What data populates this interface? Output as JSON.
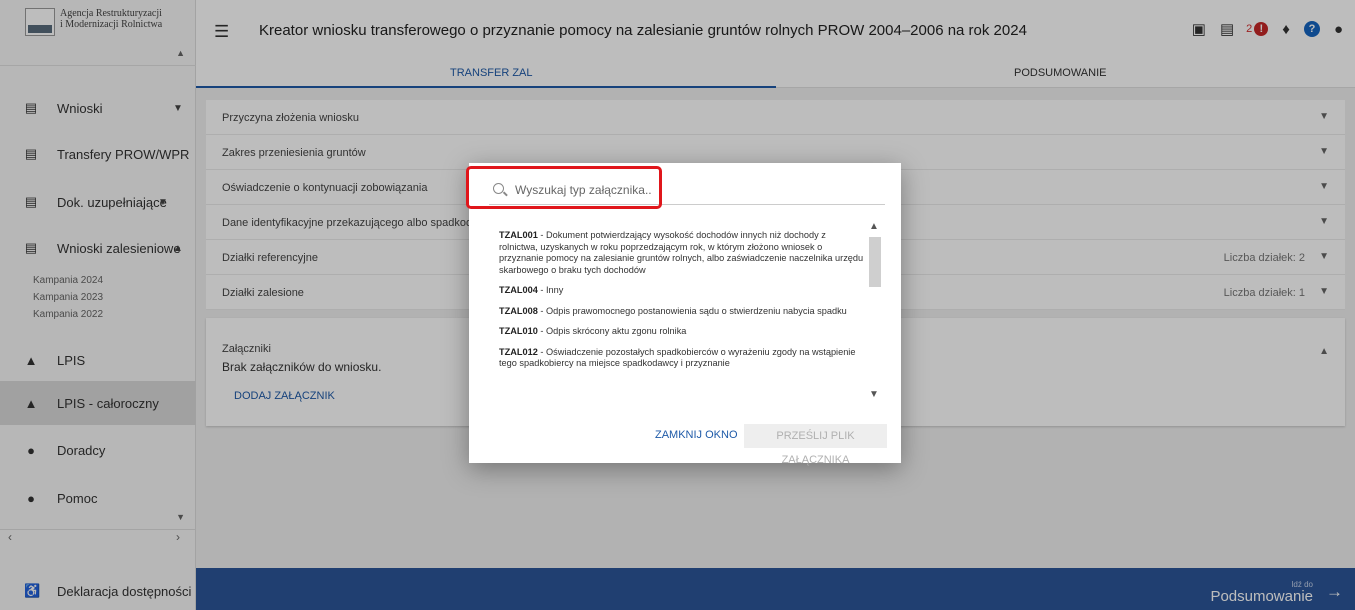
{
  "sidebar": {
    "logo_line1": "Agencja Restrukturyzacji",
    "logo_line2": "i Modernizacji Rolnictwa",
    "items": [
      {
        "label": "Wnioski",
        "icon": "clipboard-icon"
      },
      {
        "label": "Transfery PROW/WPR",
        "icon": "clipboard-icon"
      },
      {
        "label": "Dok. uzupełniające",
        "icon": "clipboard-icon"
      },
      {
        "label": "Wnioski zalesieniowe",
        "icon": "clipboard-icon"
      },
      {
        "label": "LPIS",
        "icon": "mountain-icon"
      },
      {
        "label": "LPIS - całoroczny",
        "icon": "mountain-icon"
      },
      {
        "label": "Doradcy",
        "icon": "person-icon"
      },
      {
        "label": "Pomoc",
        "icon": "help-icon"
      }
    ],
    "campaigns": [
      "Kampania 2024",
      "Kampania 2023",
      "Kampania 2022"
    ],
    "accessibility": "Deklaracja dostępności"
  },
  "header": {
    "title": "Kreator wniosku transferowego o przyznanie pomocy na zalesianie gruntów rolnych PROW 2004–2006 na rok 2024",
    "alert_count": "2",
    "alert_glyph": "!",
    "help_glyph": "?"
  },
  "tabs": [
    "TRANSFER ZAL",
    "PODSUMOWANIE"
  ],
  "sections": [
    {
      "label": "Przyczyna złożenia wniosku",
      "meta": ""
    },
    {
      "label": "Zakres przeniesienia gruntów",
      "meta": ""
    },
    {
      "label": "Oświadczenie o kontynuacji zobowiązania",
      "meta": ""
    },
    {
      "label": "Dane identyfikacyjne przekazującego albo spadkodawcy",
      "meta": ""
    },
    {
      "label": "Działki referencyjne",
      "meta": "Liczba działek: 2"
    },
    {
      "label": "Działki zalesione",
      "meta": "Liczba działek: 1"
    }
  ],
  "attachments": {
    "title": "Załączniki",
    "empty": "Brak załączników do wniosku.",
    "add": "DODAJ ZAŁĄCZNIK"
  },
  "footer": {
    "next_small": "Idź do",
    "next_big": "Podsumowanie"
  },
  "dialog": {
    "search_placeholder": "Wyszukaj typ załącznika..",
    "items": [
      {
        "code": "TZAL001",
        "text": " - Dokument potwierdzający wysokość dochodów innych niż dochody z rolnictwa, uzyskanych w roku poprzedzającym rok, w którym złożono wniosek o przyznanie pomocy na zalesianie gruntów rolnych, albo zaświadczenie naczelnika urzędu skarbowego o braku tych dochodów"
      },
      {
        "code": "TZAL004",
        "text": " - Inny"
      },
      {
        "code": "TZAL008",
        "text": " - Odpis prawomocnego postanowienia sądu o stwierdzeniu nabycia spadku"
      },
      {
        "code": "TZAL010",
        "text": " - Odpis skrócony aktu zgonu rolnika"
      },
      {
        "code": "TZAL012",
        "text": " - Oświadczenie pozostałych spadkobierców o wyrażeniu zgody na wstąpienie tego spadkobiercy na miejsce spadkodawcy i przyznanie"
      }
    ],
    "close_label": "ZAMKNIJ OKNO",
    "send_label": "PRZEŚLIJ PLIK ZAŁĄCZNIKA"
  },
  "colors": {
    "accent": "#1e5aa8",
    "bottom_bar": "#2c5699",
    "highlight": "#e0161b"
  }
}
